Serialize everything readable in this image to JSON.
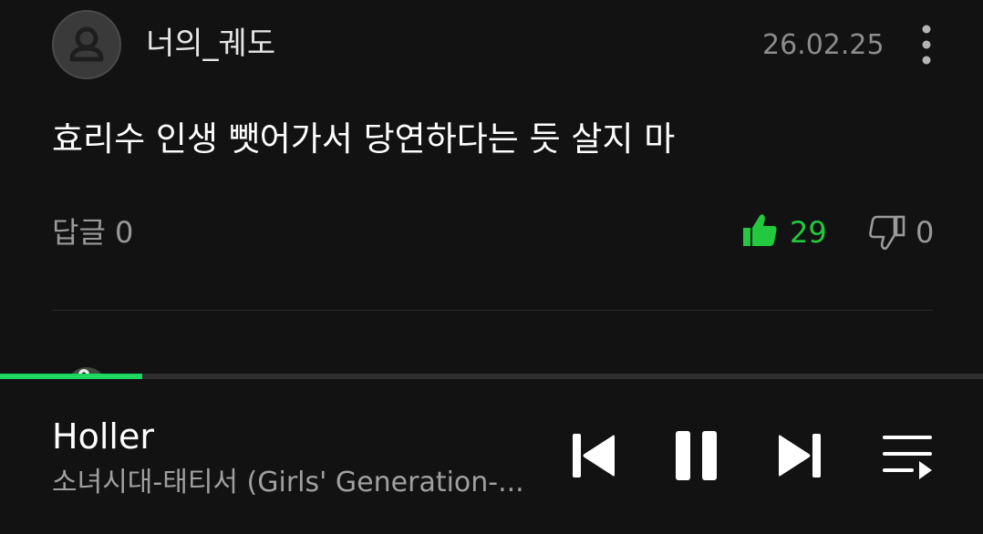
{
  "comment": {
    "username": "너의_궤도",
    "date": "26.02.25",
    "text": "효리수 인생 뺏어가서 당연하다는 듯 살지 마",
    "reply_label": "답글 0",
    "like_count": "29",
    "dislike_count": "0",
    "like_color": "#22c93e"
  },
  "player": {
    "title": "Holler",
    "artist": "소녀시대-태티서 (Girls' Generation-...",
    "progress_fraction": 0.145,
    "progress_color": "#1ed760"
  },
  "icons": {
    "avatar": "default-user-avatar",
    "more": "more-vertical-icon",
    "like": "thumbs-up-filled-icon",
    "dislike": "thumbs-down-outline-icon",
    "prev": "skip-previous-icon",
    "pause": "pause-icon",
    "next": "skip-next-icon",
    "queue": "queue-playlist-icon"
  }
}
